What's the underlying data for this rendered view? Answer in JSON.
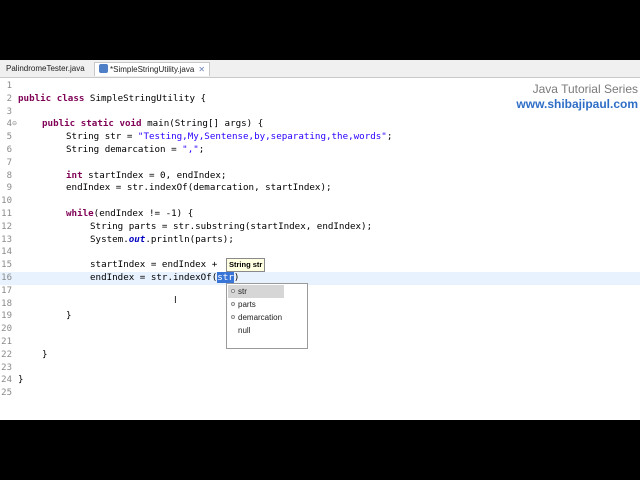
{
  "tabs": [
    {
      "label": "PalindromeTester.java",
      "active": false
    },
    {
      "label": "*SimpleStringUtility.java",
      "active": true
    }
  ],
  "tab_close_glyph": "✕",
  "branding": {
    "line1": "Java Tutorial Series",
    "line2": "www.shibajipaul.com"
  },
  "line_numbers": [
    "1",
    "2",
    "3",
    "4",
    "5",
    "6",
    "7",
    "8",
    "9",
    "10",
    "11",
    "12",
    "13",
    "14",
    "15",
    "16",
    "17",
    "18",
    "19",
    "20",
    "21",
    "22",
    "23",
    "24",
    "25"
  ],
  "code": {
    "l2_kw": "public class",
    "l2_rest": " SimpleStringUtility {",
    "l4_kw": "public static void",
    "l4_rest": " main(String[] args) {",
    "l5_a": "String str = ",
    "l5_str": "\"Testing,My,Sentense,by,separating,the,words\"",
    "l5_b": ";",
    "l6_a": "String demarcation = ",
    "l6_str": "\",\"",
    "l6_b": ";",
    "l8_kw": "int",
    "l8_rest": " startIndex = 0, endIndex;",
    "l9": "endIndex = str.indexOf(demarcation, startIndex);",
    "l11_kw": "while",
    "l11_rest": "(endIndex != -1) {",
    "l12": "String parts = str.substring(startIndex, endIndex);",
    "l13_a": "System.",
    "l13_it": "out",
    "l13_b": ".println(parts);",
    "l15": "startIndex = endIndex +",
    "l16_a": "endIndex = str.indexOf(",
    "l16_sel": "str",
    "l16_b": ")",
    "l19": "}",
    "l22": "}",
    "l24": "}"
  },
  "hint": "String str",
  "autocomplete": [
    "str",
    "parts",
    "demarcation",
    "null"
  ]
}
